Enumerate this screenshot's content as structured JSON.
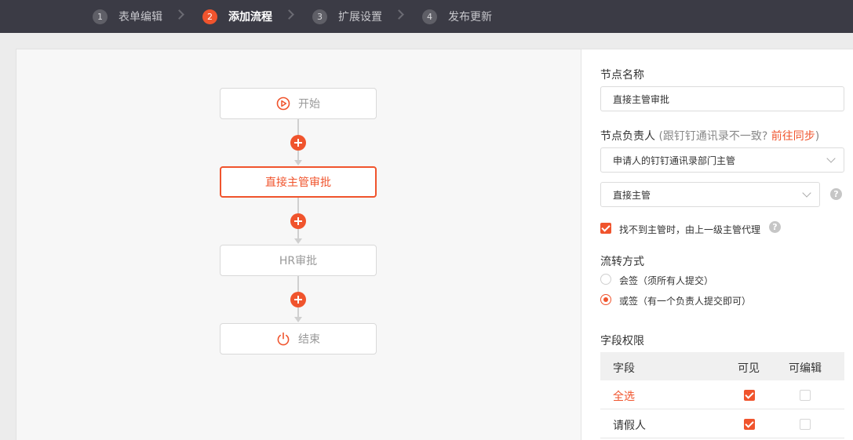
{
  "steps": [
    {
      "num": "1",
      "label": "表单编辑"
    },
    {
      "num": "2",
      "label": "添加流程",
      "active": true
    },
    {
      "num": "3",
      "label": "扩展设置"
    },
    {
      "num": "4",
      "label": "发布更新"
    }
  ],
  "flow": {
    "start": "开始",
    "approver1": "直接主管审批",
    "approver2": "HR审批",
    "end": "结束"
  },
  "panel": {
    "node_name_label": "节点名称",
    "node_name_value": "直接主管审批",
    "owner_label": "节点负责人",
    "owner_hint_open": " (跟钉钉通讯录不一致? ",
    "owner_link": "前往同步",
    "owner_hint_close": ")",
    "owner_select": "申请人的钉钉通讯录部门主管",
    "supervisor_select": "直接主管",
    "fallback_checkbox": "找不到主管时，由上一级主管代理",
    "fallback_checked": true,
    "flow_mode_label": "流转方式",
    "mode_options": [
      {
        "label": "会签（须所有人提交）",
        "selected": false
      },
      {
        "label": "或签（有一个负责人提交即可）",
        "selected": true
      }
    ],
    "field_perm_label": "字段权限",
    "table": {
      "headers": {
        "field": "字段",
        "visible": "可见",
        "editable": "可编辑"
      },
      "rows": [
        {
          "field": "全选",
          "visible": true,
          "editable": false
        },
        {
          "field": "请假人",
          "visible": true,
          "editable": false
        }
      ]
    },
    "help_glyph": "?"
  },
  "colors": {
    "accent": "#f0542d",
    "topbar": "#3b3b45"
  }
}
